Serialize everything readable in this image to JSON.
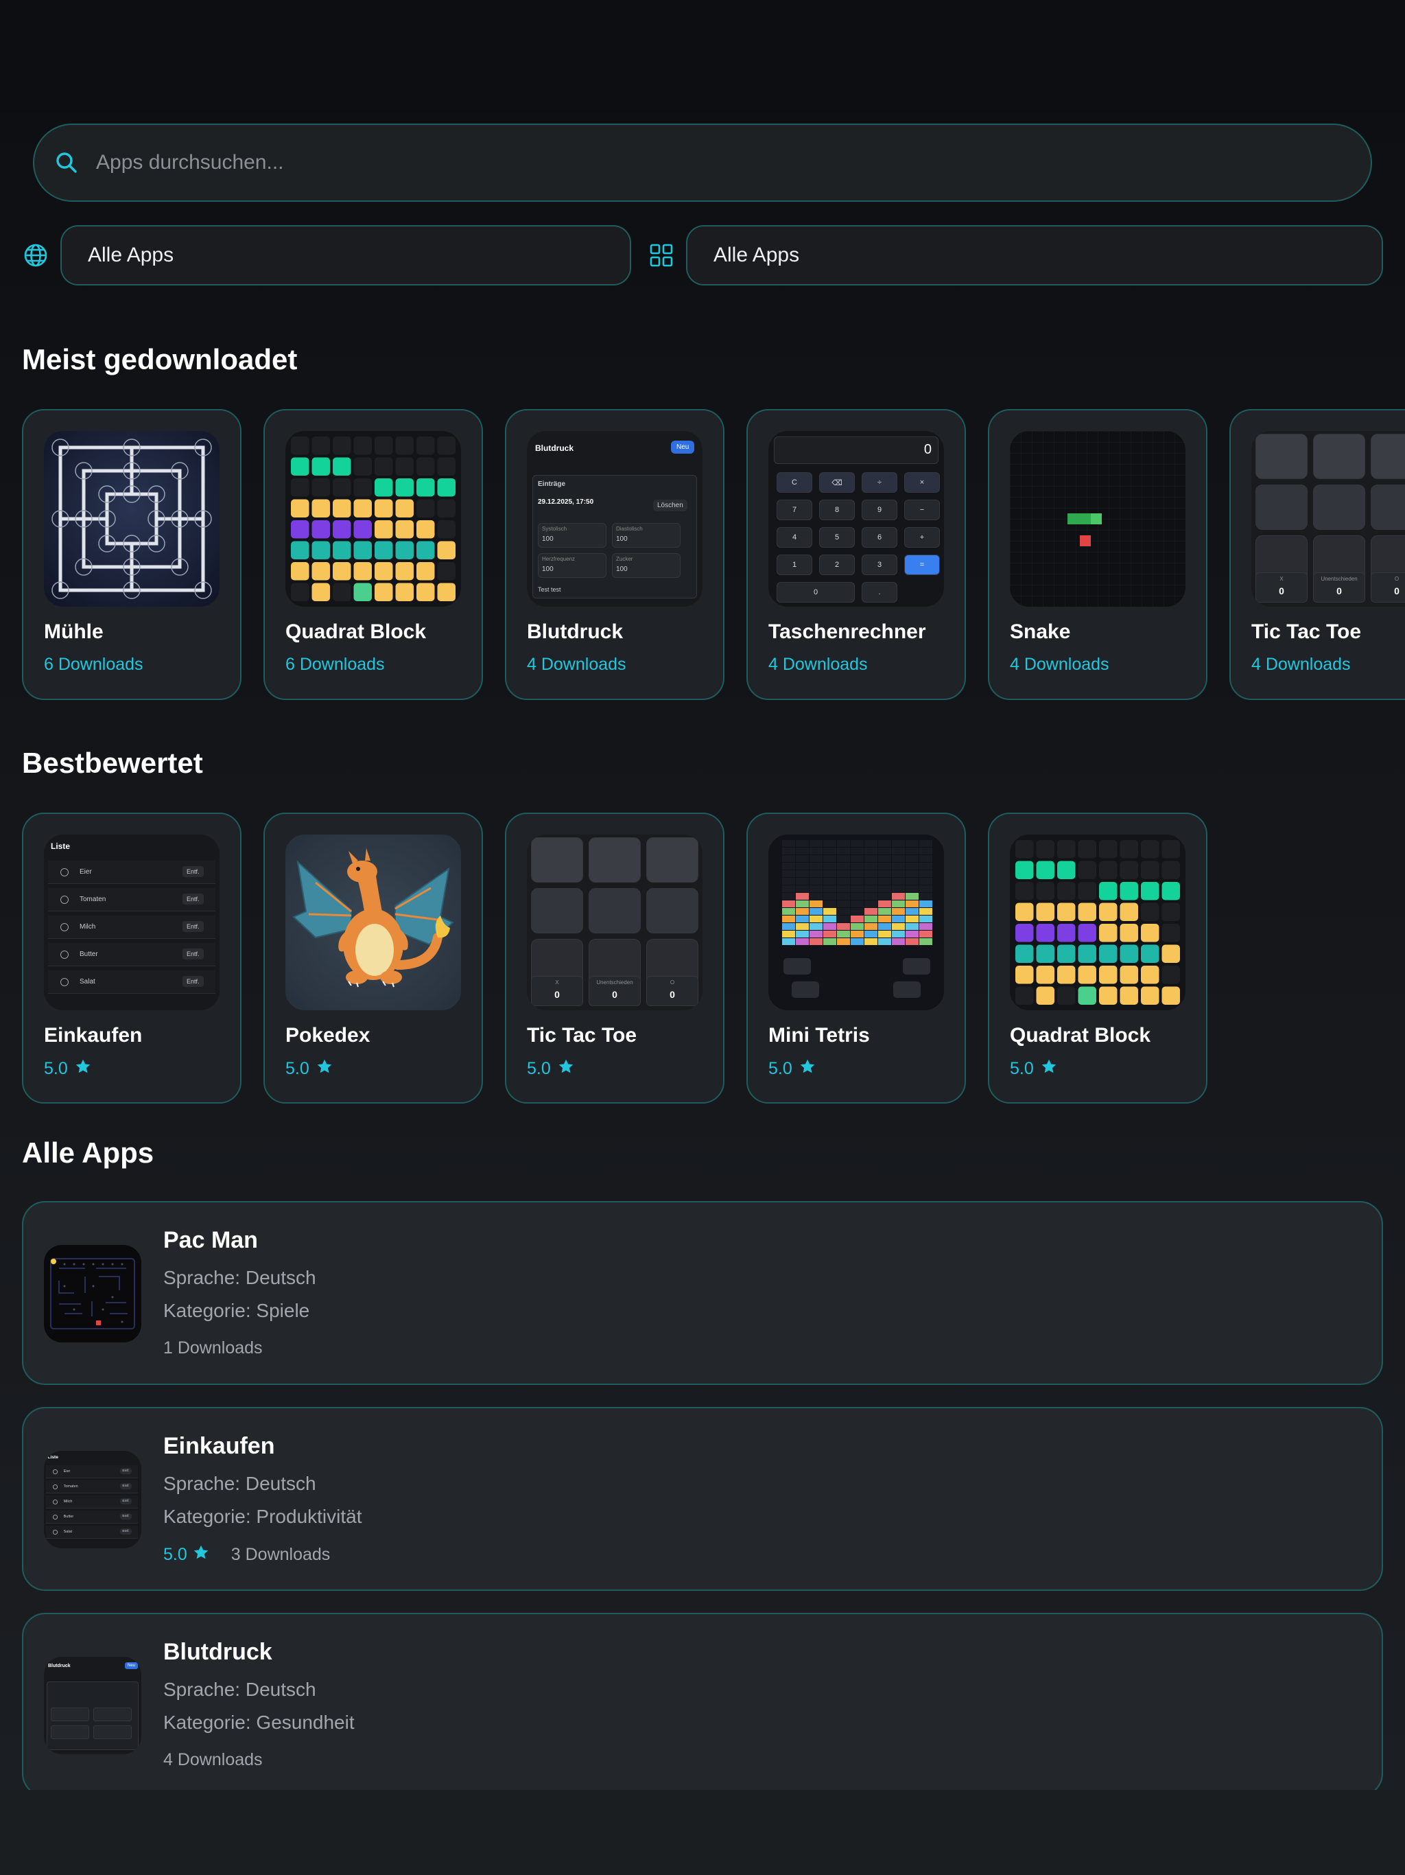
{
  "search": {
    "placeholder": "Apps durchsuchen..."
  },
  "filters": {
    "language": "Alle Apps",
    "category": "Alle Apps"
  },
  "sections": {
    "most_downloaded": "Meist gedownloadet",
    "top_rated": "Bestbewertet",
    "all_apps": "Alle Apps"
  },
  "most_downloaded": [
    {
      "name": "Mühle",
      "downloads": "6 Downloads"
    },
    {
      "name": "Quadrat Block",
      "downloads": "6 Downloads"
    },
    {
      "name": "Blutdruck",
      "downloads": "4 Downloads"
    },
    {
      "name": "Taschenrechner",
      "downloads": "4 Downloads"
    },
    {
      "name": "Snake",
      "downloads": "4 Downloads"
    },
    {
      "name": "Tic Tac Toe",
      "downloads": "4 Downloads"
    }
  ],
  "top_rated": [
    {
      "name": "Einkaufen",
      "rating": "5.0"
    },
    {
      "name": "Pokedex",
      "rating": "5.0"
    },
    {
      "name": "Tic Tac Toe",
      "rating": "5.0"
    },
    {
      "name": "Mini Tetris",
      "rating": "5.0"
    },
    {
      "name": "Quadrat Block",
      "rating": "5.0"
    }
  ],
  "all_apps": [
    {
      "name": "Pac Man",
      "language": "Sprache: Deutsch",
      "category": "Kategorie: Spiele",
      "rating": "",
      "downloads": "1 Downloads"
    },
    {
      "name": "Einkaufen",
      "language": "Sprache: Deutsch",
      "category": "Kategorie: Produktivität",
      "rating": "5.0",
      "downloads": "3 Downloads"
    },
    {
      "name": "Blutdruck",
      "language": "Sprache: Deutsch",
      "category": "Kategorie: Gesundheit",
      "rating": "",
      "downloads": "4 Downloads"
    }
  ],
  "thumbs": {
    "blutdruck": {
      "title": "Blutdruck",
      "new": "Neu",
      "entries": "Einträge",
      "date": "29.12.2025, 17:50",
      "delete": "Löschen",
      "f1": "Systolisch",
      "f2": "Diastolisch",
      "f3": "Herzfrequenz",
      "f4": "Zucker",
      "v": "100",
      "note": "Test test"
    },
    "calc": {
      "display": "0",
      "keys": [
        "C",
        "⌫",
        "÷",
        "×",
        "7",
        "8",
        "9",
        "−",
        "4",
        "5",
        "6",
        "+",
        "1",
        "2",
        "3",
        "=",
        "0",
        "."
      ]
    },
    "ttt": {
      "x": "X",
      "draw": "Unentschieden",
      "o": "O",
      "zero": "0"
    },
    "einkaufen": {
      "title": "Liste",
      "items": [
        "Eier",
        "Tomaten",
        "Milch",
        "Butter",
        "Salat"
      ],
      "remove": "Entf."
    }
  },
  "colors": {
    "accent": "#22c7de",
    "border": "#1f5c5e",
    "card": "#1f2226"
  }
}
